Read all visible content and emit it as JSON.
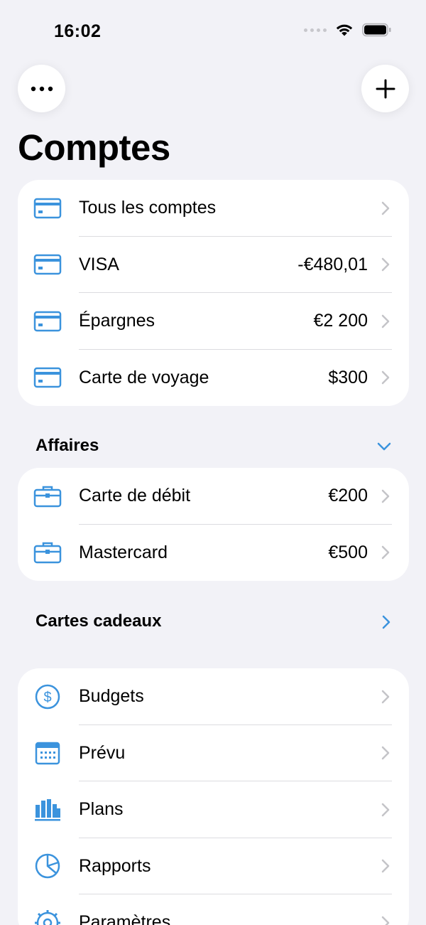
{
  "status": {
    "time": "16:02"
  },
  "title": "Comptes",
  "accounts": [
    {
      "label": "Tous les comptes",
      "value": ""
    },
    {
      "label": "VISA",
      "value": "-€480,01"
    },
    {
      "label": "Épargnes",
      "value": "€2 200"
    },
    {
      "label": "Carte de voyage",
      "value": "$300"
    }
  ],
  "business": {
    "header": "Affaires",
    "items": [
      {
        "label": "Carte de débit",
        "value": "€200"
      },
      {
        "label": "Mastercard",
        "value": "€500"
      }
    ]
  },
  "gift_cards": {
    "header": "Cartes cadeaux"
  },
  "tools": [
    {
      "label": "Budgets",
      "icon": "dollar-circle-icon"
    },
    {
      "label": "Prévu",
      "icon": "calendar-icon"
    },
    {
      "label": "Plans",
      "icon": "bar-chart-icon"
    },
    {
      "label": "Rapports",
      "icon": "pie-chart-icon"
    },
    {
      "label": "Paramètres",
      "icon": "gear-icon"
    }
  ],
  "colors": {
    "accent": "#3b93dd",
    "background": "#f2f2f7",
    "card": "#ffffff"
  }
}
